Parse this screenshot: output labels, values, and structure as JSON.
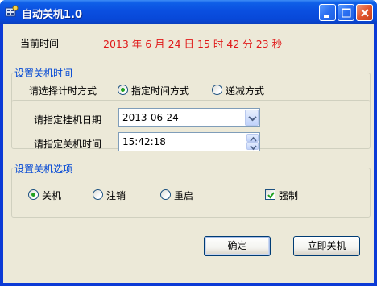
{
  "window": {
    "title": "自动关机1.0",
    "icons": {
      "app": "app-icon",
      "minimize": "minimize-icon",
      "maximize": "maximize-icon",
      "close": "close-icon"
    }
  },
  "current_time": {
    "label": "当前时间",
    "value": "2013 年 6 月 24 日  15 时 42 分 23 秒"
  },
  "shutdown_time_group": {
    "title": "设置关机时间",
    "mode_label": "请选择计时方式",
    "modes": [
      {
        "label": "指定时间方式",
        "selected": true
      },
      {
        "label": "递减方式",
        "selected": false
      }
    ],
    "date_label": "请指定挂机日期",
    "date_value": "2013-06-24",
    "time_label": "请指定关机时间",
    "time_value": "15:42:18"
  },
  "options_group": {
    "title": "设置关机选项",
    "actions": [
      {
        "label": "关机",
        "selected": true
      },
      {
        "label": "注销",
        "selected": false
      },
      {
        "label": "重启",
        "selected": false
      }
    ],
    "force": {
      "label": "强制",
      "checked": true
    }
  },
  "buttons": {
    "ok": "确定",
    "shutdown_now": "立即关机"
  },
  "colors": {
    "time_text": "#e01818",
    "group_title": "#0046d5",
    "titlebar": "#0a4fe0"
  }
}
